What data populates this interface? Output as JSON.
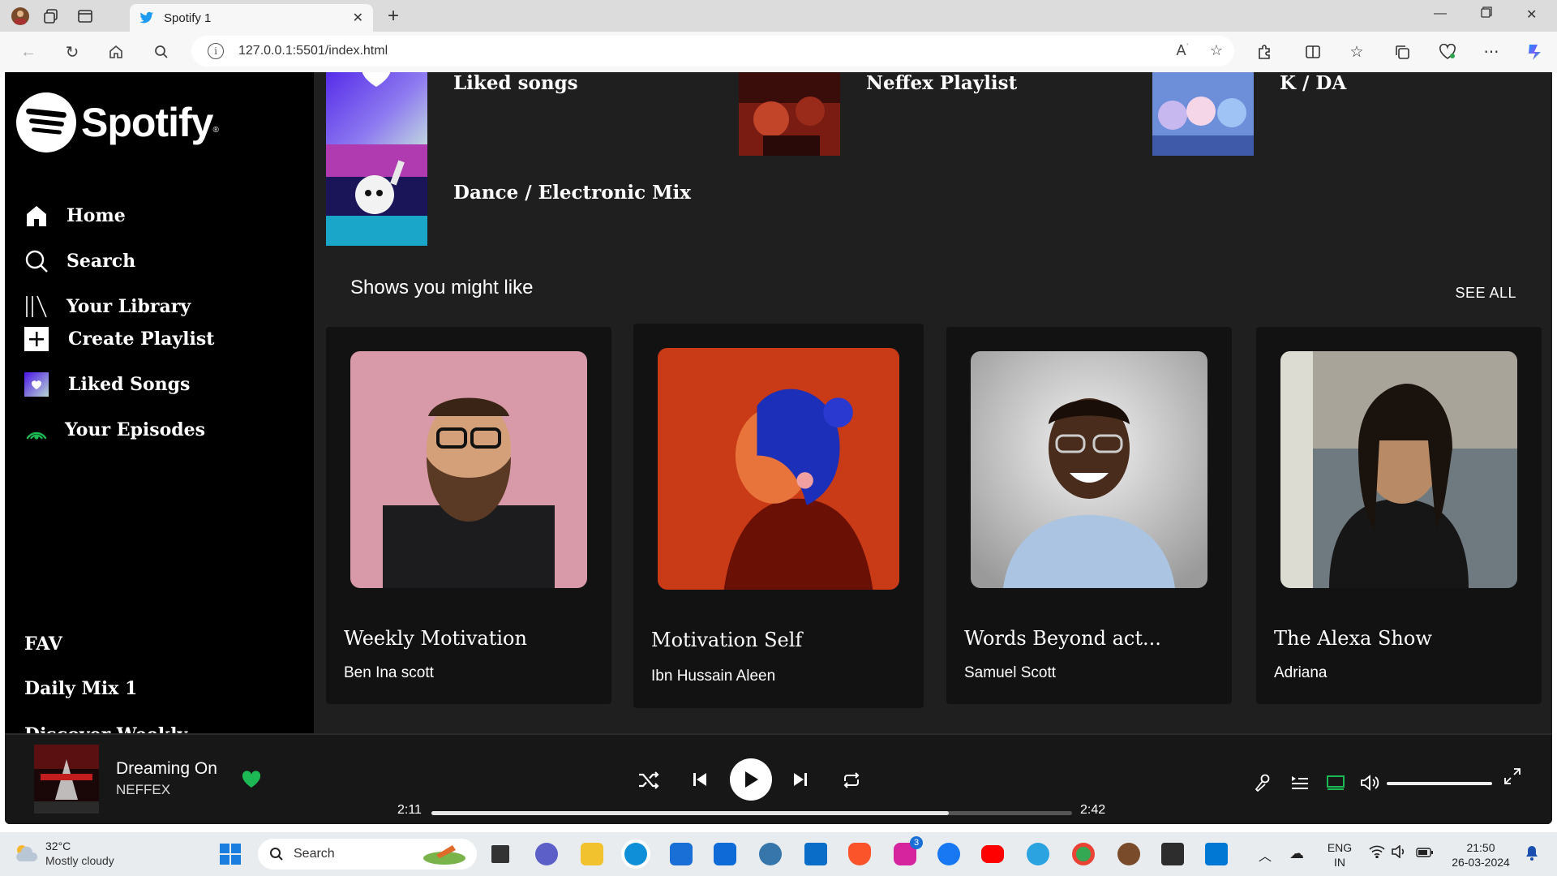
{
  "browser": {
    "tab_title": "Spotify 1",
    "url": "127.0.0.1:5501/index.html"
  },
  "sidebar": {
    "logo_text": "Spotify",
    "nav": [
      {
        "label": "Home",
        "icon": "home-icon"
      },
      {
        "label": "Search",
        "icon": "search-icon"
      },
      {
        "label": "Your Library",
        "icon": "library-icon"
      }
    ],
    "actions": [
      {
        "label": "Create Playlist",
        "icon": "plus-icon"
      },
      {
        "label": "Liked Songs",
        "icon": "heart-icon"
      },
      {
        "label": "Your Episodes",
        "icon": "podcast-icon"
      }
    ],
    "playlists": [
      "FAV",
      "Daily Mix 1",
      "Discover Weekly"
    ]
  },
  "main": {
    "playlists": [
      {
        "title": "Liked songs"
      },
      {
        "title": "Neffex Playlist"
      },
      {
        "title": "K / DA"
      },
      {
        "title": "Dance / Electronic Mix"
      }
    ],
    "shows_title": "Shows you might like",
    "see_all": "SEE ALL",
    "shows": [
      {
        "title": "Weekly Motivation",
        "author": "Ben Ina scott"
      },
      {
        "title": "Motivation Self",
        "author": "Ibn Hussain Aleen"
      },
      {
        "title": "Words Beyond act...",
        "author": "Samuel Scott"
      },
      {
        "title": "The Alexa Show",
        "author": "Adriana"
      }
    ]
  },
  "player": {
    "track": "Dreaming On",
    "artist": "NEFFEX",
    "current_time": "2:11",
    "total_time": "2:42",
    "progress_fraction": 0.807,
    "volume_fraction": 1.0,
    "accent": "#1db954"
  },
  "taskbar": {
    "temp": "32°C",
    "weather": "Mostly cloudy",
    "search": "Search",
    "lang": "ENG",
    "region": "IN",
    "time": "21:50",
    "date": "26-03-2024",
    "instagram_badge": "3"
  }
}
